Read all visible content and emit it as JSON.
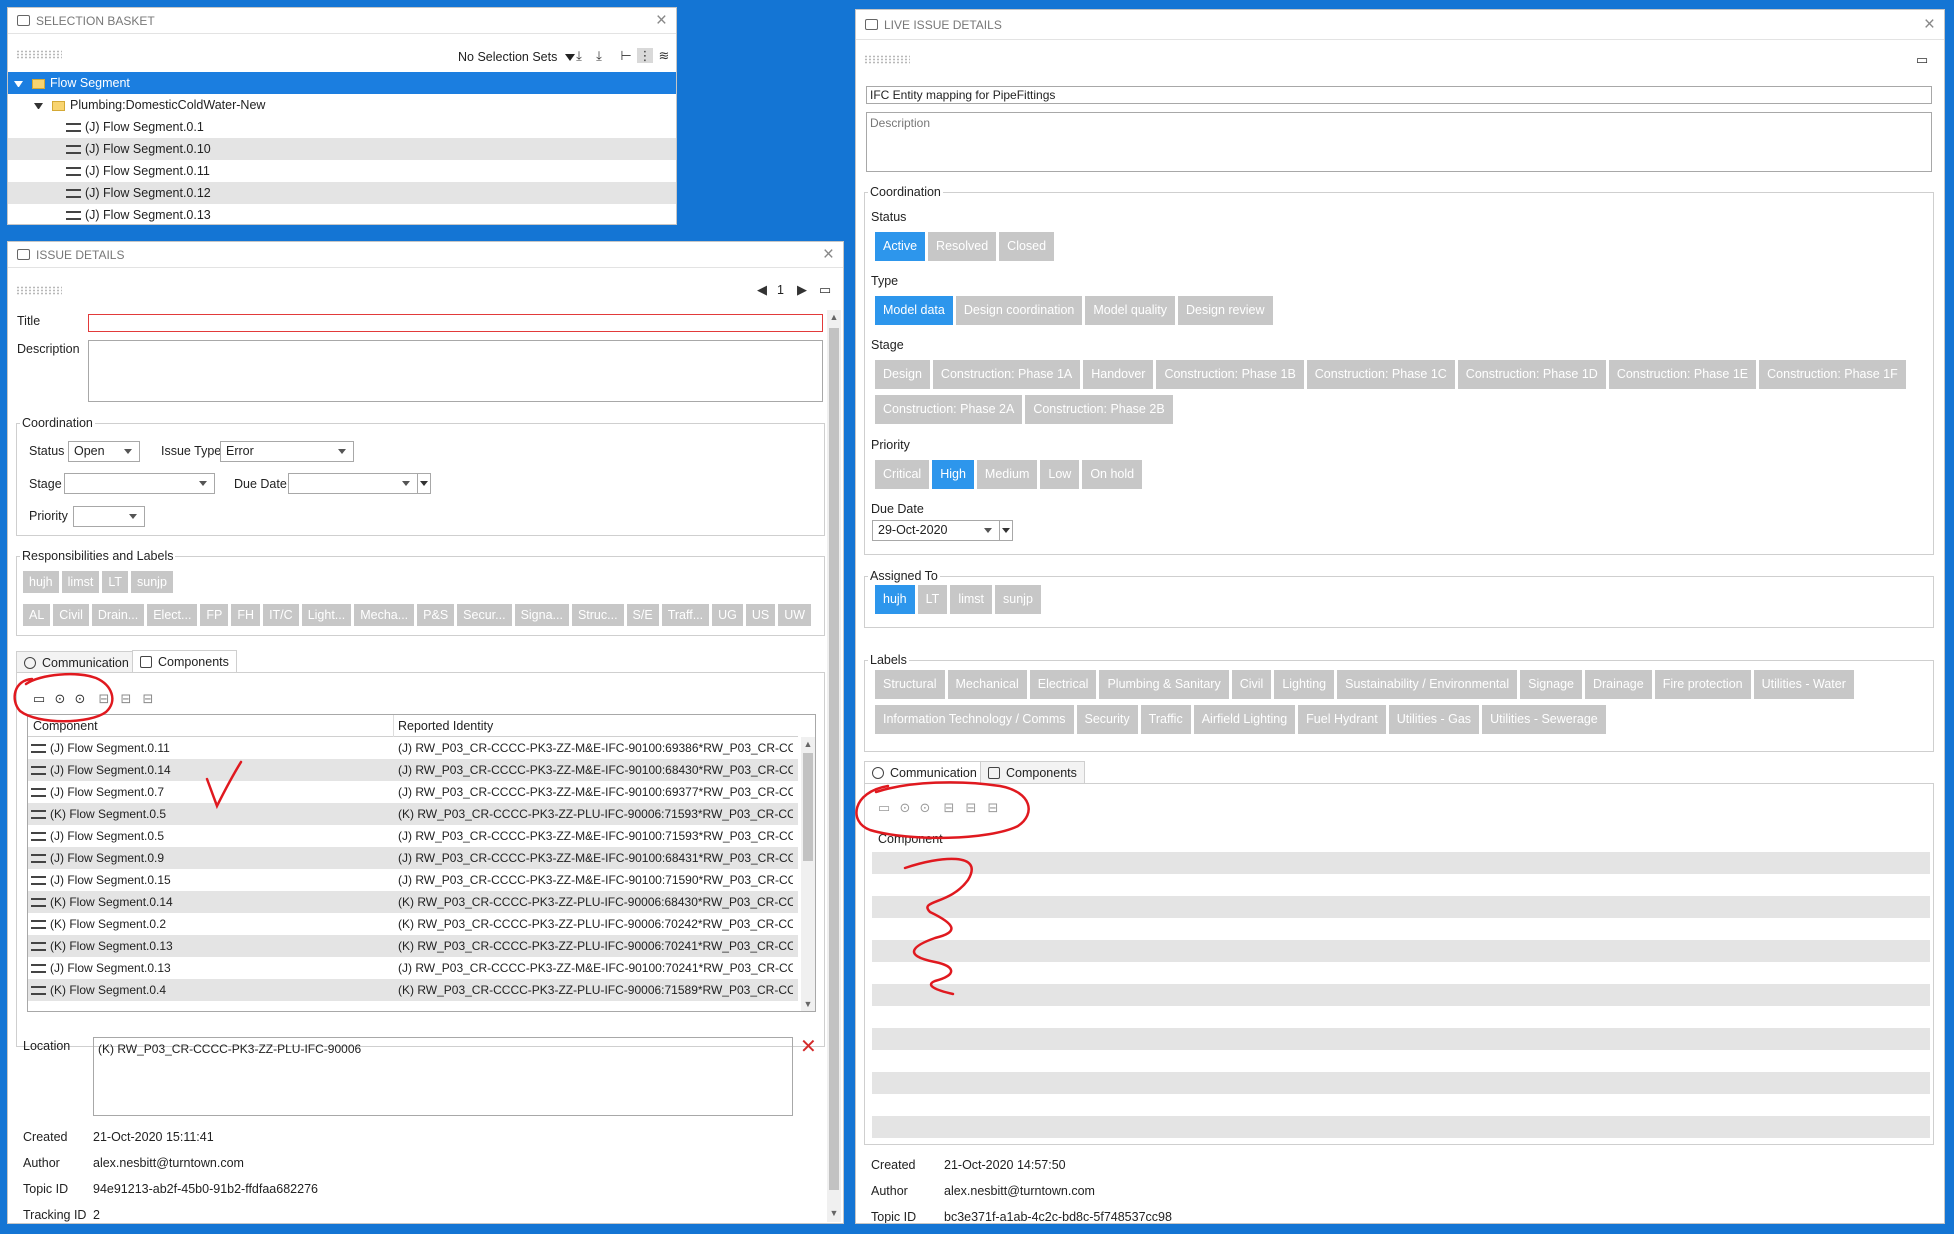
{
  "selection_basket": {
    "title": "SELECTION BASKET",
    "selection_sets": "No Selection Sets",
    "items": [
      {
        "label": "Flow Segment",
        "level": 0,
        "kind": "folder",
        "selected": true
      },
      {
        "label": "Plumbing:DomesticColdWater-New",
        "level": 1,
        "kind": "folder"
      },
      {
        "label": "(J) Flow Segment.0.1",
        "level": 2,
        "kind": "segment"
      },
      {
        "label": "(J) Flow Segment.0.10",
        "level": 2,
        "kind": "segment",
        "shaded": true
      },
      {
        "label": "(J) Flow Segment.0.11",
        "level": 2,
        "kind": "segment"
      },
      {
        "label": "(J) Flow Segment.0.12",
        "level": 2,
        "kind": "segment",
        "shaded": true
      },
      {
        "label": "(J) Flow Segment.0.13",
        "level": 2,
        "kind": "segment"
      }
    ]
  },
  "issue_details": {
    "title": "ISSUE DETAILS",
    "page": "1",
    "labels": {
      "title": "Title",
      "description": "Description",
      "coordination": "Coordination",
      "status": "Status",
      "issue_type": "Issue Type",
      "stage": "Stage",
      "due_date": "Due Date",
      "priority": "Priority",
      "responsibilities": "Responsibilities and Labels",
      "location": "Location",
      "created": "Created",
      "author": "Author",
      "topic_id": "Topic ID",
      "tracking_id": "Tracking ID"
    },
    "title_value": "",
    "description_value": "",
    "status": "Open",
    "issue_type": "Error",
    "stage": "",
    "due_date": "",
    "priority": "",
    "responsibilities": [
      "hujh",
      "limst",
      "LT",
      "sunjp"
    ],
    "labels_row": [
      "AL",
      "Civil",
      "Drain...",
      "Elect...",
      "FP",
      "FH",
      "IT/C",
      "Light...",
      "Mecha...",
      "P&S",
      "Secur...",
      "Signa...",
      "Struc...",
      "S/E",
      "Traff...",
      "UG",
      "US",
      "UW"
    ],
    "tabs": {
      "communication": "Communication",
      "components": "Components"
    },
    "table_headers": {
      "component": "Component",
      "reported_identity": "Reported Identity"
    },
    "rows": [
      {
        "component": "(J) Flow Segment.0.11",
        "identity": "(J) RW_P03_CR-CCCC-PK3-ZZ-M&E-IFC-90100:69386*RW_P03_CR-CCC..."
      },
      {
        "component": "(J) Flow Segment.0.14",
        "identity": "(J) RW_P03_CR-CCCC-PK3-ZZ-M&E-IFC-90100:68430*RW_P03_CR-CCC..."
      },
      {
        "component": "(J) Flow Segment.0.7",
        "identity": "(J) RW_P03_CR-CCCC-PK3-ZZ-M&E-IFC-90100:69377*RW_P03_CR-CCC..."
      },
      {
        "component": "(K) Flow Segment.0.5",
        "identity": "(K) RW_P03_CR-CCCC-PK3-ZZ-PLU-IFC-90006:71593*RW_P03_CR-CCCC..."
      },
      {
        "component": "(J) Flow Segment.0.5",
        "identity": "(J) RW_P03_CR-CCCC-PK3-ZZ-M&E-IFC-90100:71593*RW_P03_CR-CCC..."
      },
      {
        "component": "(J) Flow Segment.0.9",
        "identity": "(J) RW_P03_CR-CCCC-PK3-ZZ-M&E-IFC-90100:68431*RW_P03_CR-CCC..."
      },
      {
        "component": "(J) Flow Segment.0.15",
        "identity": "(J) RW_P03_CR-CCCC-PK3-ZZ-M&E-IFC-90100:71590*RW_P03_CR-CCC..."
      },
      {
        "component": "(K) Flow Segment.0.14",
        "identity": "(K) RW_P03_CR-CCCC-PK3-ZZ-PLU-IFC-90006:68430*RW_P03_CR-CCCC..."
      },
      {
        "component": "(K) Flow Segment.0.2",
        "identity": "(K) RW_P03_CR-CCCC-PK3-ZZ-PLU-IFC-90006:70242*RW_P03_CR-CCCC..."
      },
      {
        "component": "(K) Flow Segment.0.13",
        "identity": "(K) RW_P03_CR-CCCC-PK3-ZZ-PLU-IFC-90006:70241*RW_P03_CR-CCCC..."
      },
      {
        "component": "(J) Flow Segment.0.13",
        "identity": "(J) RW_P03_CR-CCCC-PK3-ZZ-M&E-IFC-90100:70241*RW_P03_CR-CCC..."
      },
      {
        "component": "(K) Flow Segment.0.4",
        "identity": "(K) RW_P03_CR-CCCC-PK3-ZZ-PLU-IFC-90006:71589*RW_P03_CR-CCCC..."
      }
    ],
    "location": "(K) RW_P03_CR-CCCC-PK3-ZZ-PLU-IFC-90006",
    "created": "21-Oct-2020 15:11:41",
    "author": "alex.nesbitt@turntown.com",
    "topic_id": "94e91213-ab2f-45b0-91b2-ffdfaa682276",
    "tracking_id": "2"
  },
  "live_issue": {
    "title": "LIVE ISSUE DETAILS",
    "title_value": "IFC Entity mapping for PipeFittings",
    "description_placeholder": "Description",
    "labels": {
      "coordination": "Coordination",
      "status": "Status",
      "type": "Type",
      "stage": "Stage",
      "priority": "Priority",
      "due_date": "Due Date",
      "assigned_to": "Assigned To",
      "labels": "Labels",
      "created": "Created",
      "author": "Author",
      "topic_id": "Topic ID",
      "component": "Component"
    },
    "status": [
      {
        "label": "Active",
        "selected": true
      },
      {
        "label": "Resolved"
      },
      {
        "label": "Closed"
      }
    ],
    "type": [
      {
        "label": "Model data",
        "selected": true
      },
      {
        "label": "Design coordination"
      },
      {
        "label": "Model quality"
      },
      {
        "label": "Design review"
      }
    ],
    "stage": [
      {
        "label": "Design"
      },
      {
        "label": "Construction: Phase 1A"
      },
      {
        "label": "Handover"
      },
      {
        "label": "Construction: Phase 1B"
      },
      {
        "label": "Construction: Phase 1C"
      },
      {
        "label": "Construction: Phase 1D"
      },
      {
        "label": "Construction: Phase 1E"
      },
      {
        "label": "Construction: Phase 1F"
      },
      {
        "label": "Construction: Phase 2A"
      },
      {
        "label": "Construction: Phase 2B"
      }
    ],
    "priority": [
      {
        "label": "Critical"
      },
      {
        "label": "High",
        "selected": true
      },
      {
        "label": "Medium"
      },
      {
        "label": "Low"
      },
      {
        "label": "On hold"
      }
    ],
    "due_date": "29-Oct-2020",
    "assigned_to": [
      {
        "label": "hujh",
        "selected": true
      },
      {
        "label": "LT"
      },
      {
        "label": "limst"
      },
      {
        "label": "sunjp"
      }
    ],
    "labels_list": [
      {
        "label": "Structural"
      },
      {
        "label": "Mechanical"
      },
      {
        "label": "Electrical"
      },
      {
        "label": "Plumbing & Sanitary"
      },
      {
        "label": "Civil"
      },
      {
        "label": "Lighting"
      },
      {
        "label": "Sustainability / Environmental"
      },
      {
        "label": "Signage"
      },
      {
        "label": "Drainage"
      },
      {
        "label": "Fire protection"
      },
      {
        "label": "Utilities - Water"
      },
      {
        "label": "Information Technology / Comms"
      },
      {
        "label": "Security"
      },
      {
        "label": "Traffic"
      },
      {
        "label": "Airfield Lighting"
      },
      {
        "label": "Fuel Hydrant"
      },
      {
        "label": "Utilities - Gas"
      },
      {
        "label": "Utilities - Sewerage"
      }
    ],
    "tabs": {
      "communication": "Communication",
      "components": "Components"
    },
    "created": "21-Oct-2020 14:57:50",
    "author": "alex.nesbitt@turntown.com",
    "topic_id": "bc3e371f-a1ab-4c2c-bd8c-5f748537cc98"
  },
  "annotation_color": "#e0191f",
  "accent_color": "#2d96ec"
}
